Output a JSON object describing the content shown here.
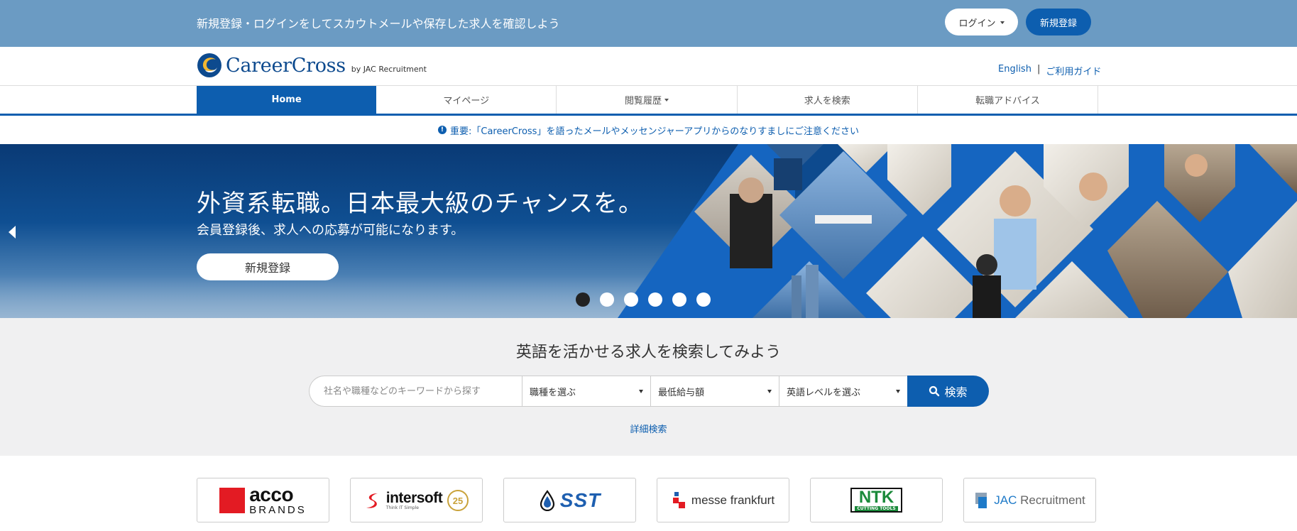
{
  "topbar": {
    "message": "新規登録・ログインをしてスカウトメールや保存した求人を確認しよう",
    "login_label": "ログイン",
    "register_label": "新規登録"
  },
  "header": {
    "logo_name": "CareerCross",
    "logo_by": "by JAC Recruitment",
    "english_link": "English",
    "separator": "|",
    "guide_link": "ご利用ガイド"
  },
  "nav": {
    "items": [
      {
        "label": "Home",
        "active": true
      },
      {
        "label": "マイページ"
      },
      {
        "label": "閲覧履歴",
        "dropdown": true
      },
      {
        "label": "求人を検索"
      },
      {
        "label": "転職アドバイス"
      }
    ]
  },
  "alert": {
    "text": "重要:「CareerCross」を語ったメールやメッセンジャーアプリからのなりすましにご注意ください"
  },
  "hero": {
    "title": "外資系転職。日本最大級のチャンスを。",
    "subtitle": "会員登録後、求人への応募が可能になります。",
    "cta_label": "新規登録",
    "slide_count": 6,
    "active_slide": 1
  },
  "search": {
    "title": "英語を活かせる求人を検索してみよう",
    "keyword_placeholder": "社名や職種などのキーワードから探す",
    "job_type_select": "職種を選ぶ",
    "salary_select": "最低給与額",
    "english_level_select": "英語レベルを選ぶ",
    "search_button": "検索",
    "advanced_link": "詳細検索"
  },
  "company_logos": {
    "acco_main": "acco",
    "acco_sub": "BRANDS",
    "intersoft_main": "intersoft",
    "intersoft_sub": "Think IT Simple",
    "intersoft_badge": "25",
    "sst": "SST",
    "messe": "messe frankfurt",
    "ntk_main": "NTK",
    "ntk_sub": "CUTTING TOOLS",
    "jac_prefix": "JAC",
    "jac_suffix": " Recruitment"
  },
  "colors": {
    "topbar": "#6b9bc3",
    "brand_blue": "#0d5eaf",
    "search_bg": "#f0f0f1"
  }
}
